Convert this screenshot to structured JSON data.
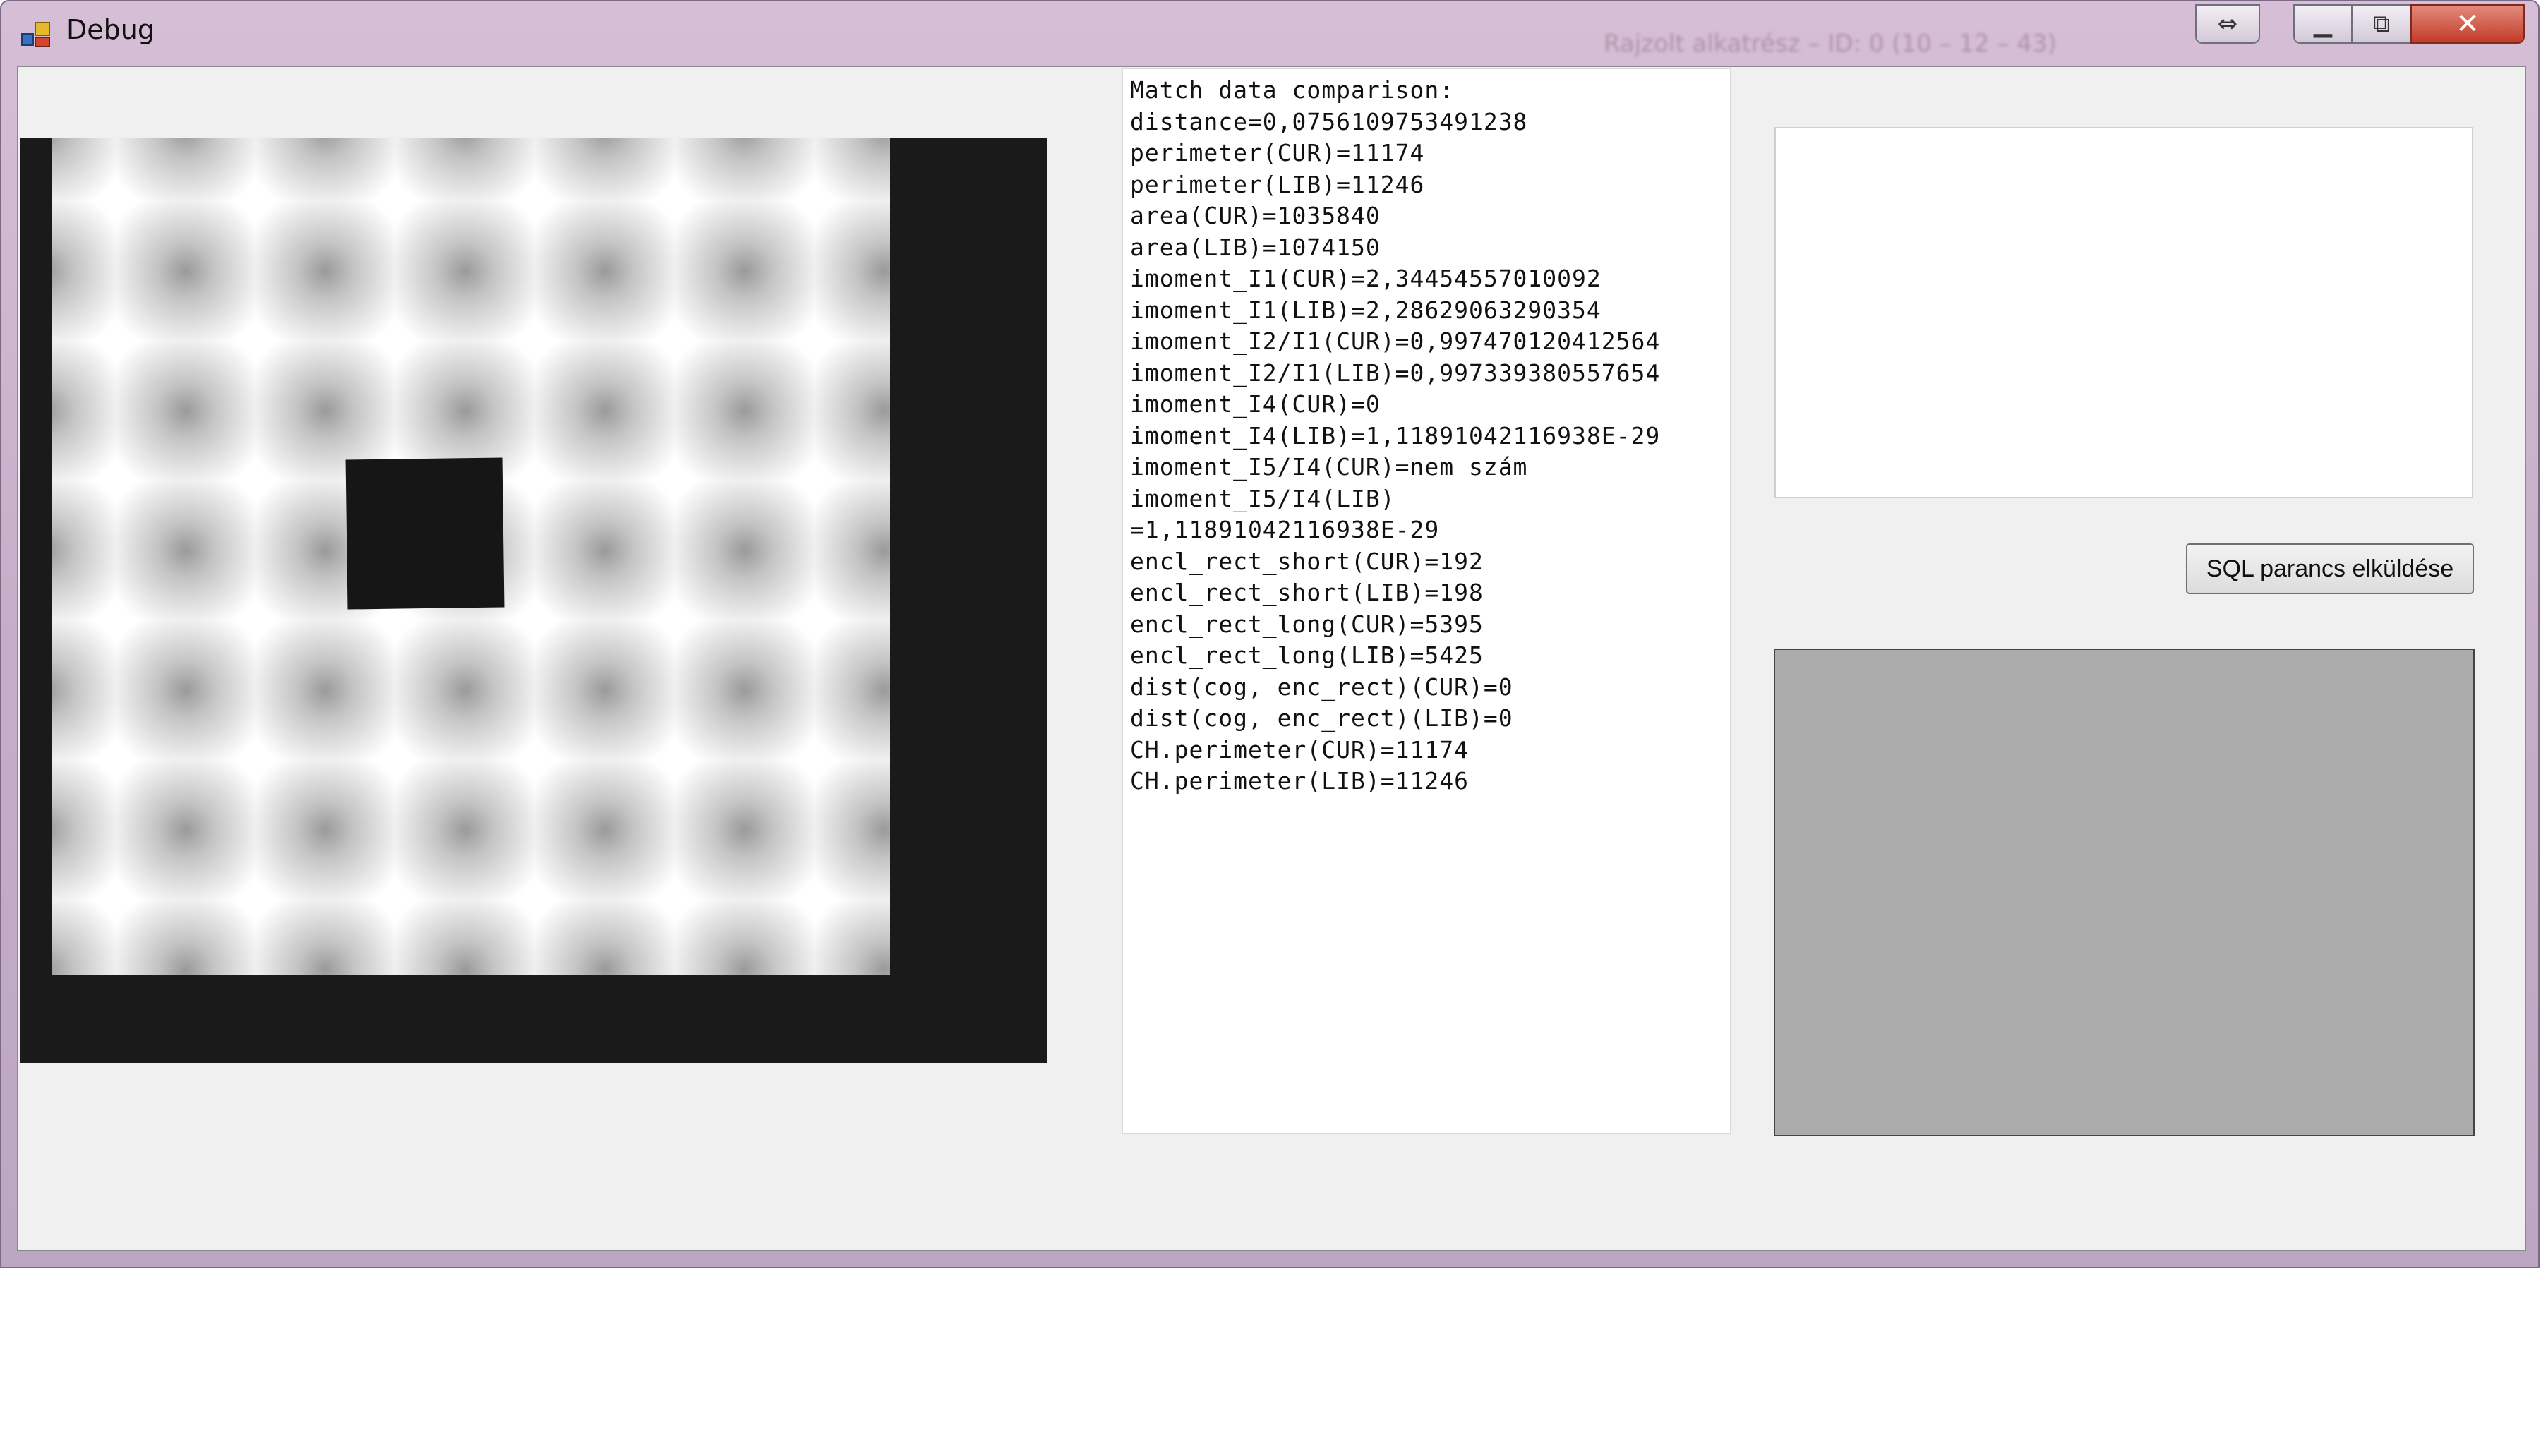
{
  "window": {
    "title": "Debug",
    "faded_title_text": "Rajzolt alkatrész – ID: 0 (10 – 12 – 43)",
    "close_glyph": "✕",
    "restore_glyph": "⧉",
    "minimize_glyph": "▁",
    "swap_glyph": "⇔"
  },
  "match_panel": {
    "lines": [
      "Match data comparison:",
      "distance=0,0756109753491238",
      "perimeter(CUR)=11174",
      "perimeter(LIB)=11246",
      "area(CUR)=1035840",
      "area(LIB)=1074150",
      "imoment_I1(CUR)=2,34454557010092",
      "imoment_I1(LIB)=2,28629063290354",
      "imoment_I2/I1(CUR)=0,997470120412564",
      "imoment_I2/I1(LIB)=0,997339380557654",
      "imoment_I4(CUR)=0",
      "imoment_I4(LIB)=1,11891042116938E-29",
      "imoment_I5/I4(CUR)=nem szám",
      "imoment_I5/I4(LIB)",
      "=1,11891042116938E-29",
      "encl_rect_short(CUR)=192",
      "encl_rect_short(LIB)=198",
      "encl_rect_long(CUR)=5395",
      "encl_rect_long(LIB)=5425",
      "dist(cog, enc_rect)(CUR)=0",
      "dist(cog, enc_rect)(LIB)=0",
      "CH.perimeter(CUR)=11174",
      "CH.perimeter(LIB)=11246"
    ]
  },
  "sql_input": {
    "value": ""
  },
  "sql_button": {
    "label": "SQL parancs elküldése"
  },
  "colors": {
    "titlebar": "#c8afc9",
    "client_bg": "#f0f0f0",
    "result_box": "#ababab",
    "close_button": "#c8402c"
  }
}
